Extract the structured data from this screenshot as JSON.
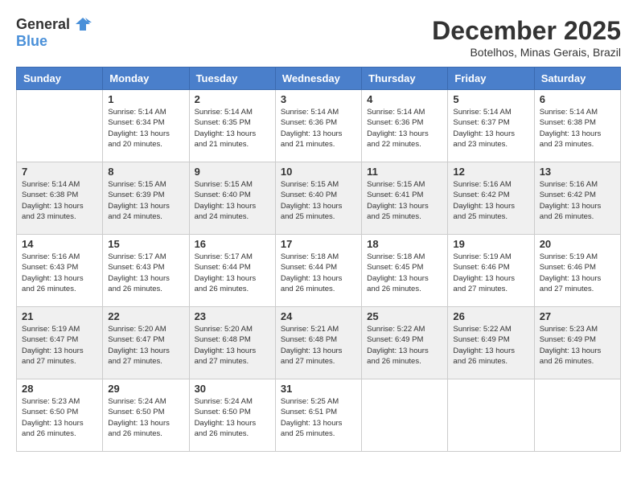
{
  "header": {
    "logo_general": "General",
    "logo_blue": "Blue",
    "month_year": "December 2025",
    "location": "Botelhos, Minas Gerais, Brazil"
  },
  "calendar": {
    "days_of_week": [
      "Sunday",
      "Monday",
      "Tuesday",
      "Wednesday",
      "Thursday",
      "Friday",
      "Saturday"
    ],
    "weeks": [
      [
        {
          "day": "",
          "info": ""
        },
        {
          "day": "1",
          "info": "Sunrise: 5:14 AM\nSunset: 6:34 PM\nDaylight: 13 hours\nand 20 minutes."
        },
        {
          "day": "2",
          "info": "Sunrise: 5:14 AM\nSunset: 6:35 PM\nDaylight: 13 hours\nand 21 minutes."
        },
        {
          "day": "3",
          "info": "Sunrise: 5:14 AM\nSunset: 6:36 PM\nDaylight: 13 hours\nand 21 minutes."
        },
        {
          "day": "4",
          "info": "Sunrise: 5:14 AM\nSunset: 6:36 PM\nDaylight: 13 hours\nand 22 minutes."
        },
        {
          "day": "5",
          "info": "Sunrise: 5:14 AM\nSunset: 6:37 PM\nDaylight: 13 hours\nand 23 minutes."
        },
        {
          "day": "6",
          "info": "Sunrise: 5:14 AM\nSunset: 6:38 PM\nDaylight: 13 hours\nand 23 minutes."
        }
      ],
      [
        {
          "day": "7",
          "info": "Sunrise: 5:14 AM\nSunset: 6:38 PM\nDaylight: 13 hours\nand 23 minutes."
        },
        {
          "day": "8",
          "info": "Sunrise: 5:15 AM\nSunset: 6:39 PM\nDaylight: 13 hours\nand 24 minutes."
        },
        {
          "day": "9",
          "info": "Sunrise: 5:15 AM\nSunset: 6:40 PM\nDaylight: 13 hours\nand 24 minutes."
        },
        {
          "day": "10",
          "info": "Sunrise: 5:15 AM\nSunset: 6:40 PM\nDaylight: 13 hours\nand 25 minutes."
        },
        {
          "day": "11",
          "info": "Sunrise: 5:15 AM\nSunset: 6:41 PM\nDaylight: 13 hours\nand 25 minutes."
        },
        {
          "day": "12",
          "info": "Sunrise: 5:16 AM\nSunset: 6:42 PM\nDaylight: 13 hours\nand 25 minutes."
        },
        {
          "day": "13",
          "info": "Sunrise: 5:16 AM\nSunset: 6:42 PM\nDaylight: 13 hours\nand 26 minutes."
        }
      ],
      [
        {
          "day": "14",
          "info": "Sunrise: 5:16 AM\nSunset: 6:43 PM\nDaylight: 13 hours\nand 26 minutes."
        },
        {
          "day": "15",
          "info": "Sunrise: 5:17 AM\nSunset: 6:43 PM\nDaylight: 13 hours\nand 26 minutes."
        },
        {
          "day": "16",
          "info": "Sunrise: 5:17 AM\nSunset: 6:44 PM\nDaylight: 13 hours\nand 26 minutes."
        },
        {
          "day": "17",
          "info": "Sunrise: 5:18 AM\nSunset: 6:44 PM\nDaylight: 13 hours\nand 26 minutes."
        },
        {
          "day": "18",
          "info": "Sunrise: 5:18 AM\nSunset: 6:45 PM\nDaylight: 13 hours\nand 26 minutes."
        },
        {
          "day": "19",
          "info": "Sunrise: 5:19 AM\nSunset: 6:46 PM\nDaylight: 13 hours\nand 27 minutes."
        },
        {
          "day": "20",
          "info": "Sunrise: 5:19 AM\nSunset: 6:46 PM\nDaylight: 13 hours\nand 27 minutes."
        }
      ],
      [
        {
          "day": "21",
          "info": "Sunrise: 5:19 AM\nSunset: 6:47 PM\nDaylight: 13 hours\nand 27 minutes."
        },
        {
          "day": "22",
          "info": "Sunrise: 5:20 AM\nSunset: 6:47 PM\nDaylight: 13 hours\nand 27 minutes."
        },
        {
          "day": "23",
          "info": "Sunrise: 5:20 AM\nSunset: 6:48 PM\nDaylight: 13 hours\nand 27 minutes."
        },
        {
          "day": "24",
          "info": "Sunrise: 5:21 AM\nSunset: 6:48 PM\nDaylight: 13 hours\nand 27 minutes."
        },
        {
          "day": "25",
          "info": "Sunrise: 5:22 AM\nSunset: 6:49 PM\nDaylight: 13 hours\nand 26 minutes."
        },
        {
          "day": "26",
          "info": "Sunrise: 5:22 AM\nSunset: 6:49 PM\nDaylight: 13 hours\nand 26 minutes."
        },
        {
          "day": "27",
          "info": "Sunrise: 5:23 AM\nSunset: 6:49 PM\nDaylight: 13 hours\nand 26 minutes."
        }
      ],
      [
        {
          "day": "28",
          "info": "Sunrise: 5:23 AM\nSunset: 6:50 PM\nDaylight: 13 hours\nand 26 minutes."
        },
        {
          "day": "29",
          "info": "Sunrise: 5:24 AM\nSunset: 6:50 PM\nDaylight: 13 hours\nand 26 minutes."
        },
        {
          "day": "30",
          "info": "Sunrise: 5:24 AM\nSunset: 6:50 PM\nDaylight: 13 hours\nand 26 minutes."
        },
        {
          "day": "31",
          "info": "Sunrise: 5:25 AM\nSunset: 6:51 PM\nDaylight: 13 hours\nand 25 minutes."
        },
        {
          "day": "",
          "info": ""
        },
        {
          "day": "",
          "info": ""
        },
        {
          "day": "",
          "info": ""
        }
      ]
    ]
  }
}
